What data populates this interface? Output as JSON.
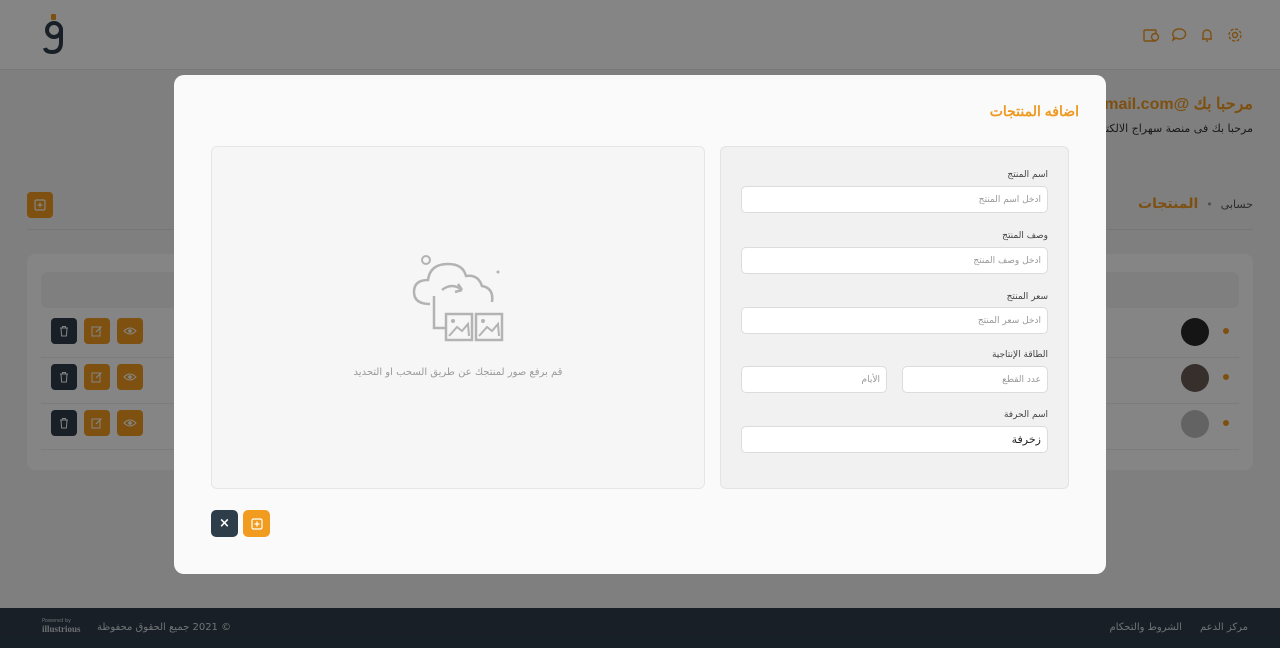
{
  "header": {
    "welcome_title": "مرحبا بك @gmail.com",
    "welcome_subtitle": "مرحبا بك فى منصة سهراج الالكترونية",
    "icons": [
      "settings-icon",
      "bell-icon",
      "chat-icon",
      "box-icon"
    ]
  },
  "page": {
    "breadcrumb_home": "حسابى",
    "breadcrumb_sep": "•",
    "breadcrumb_current": "المنتجات"
  },
  "modal": {
    "title": "اضافه المنتجات",
    "upload_hint": "قم برفع صور لمنتجك عن طريق السحب او التحديد",
    "fields": {
      "name_label": "اسم المنتج",
      "name_placeholder": "ادخل اسم المنتج",
      "desc_label": "وصف المنتج",
      "desc_placeholder": "ادخل وصف المنتج",
      "price_label": "سعر المنتج",
      "price_placeholder": "ادخل سعر المنتج",
      "capacity_label": "الطاقة الإنتاجية",
      "pieces_placeholder": "عدد القطع",
      "days_placeholder": "الأيام",
      "craft_label": "اسم الحرفة",
      "craft_value": "زخرفة"
    },
    "close_symbol": "×"
  },
  "footer": {
    "powered_small": "Powered by",
    "powered_brand": "illustrious",
    "copyright": "© 2021 جميع الحقوق محفوظة",
    "links": [
      "مركز الدعم",
      "الشروط والتحكام"
    ]
  },
  "colors": {
    "accent": "#f29c1f",
    "dark": "#2e3d4a"
  }
}
